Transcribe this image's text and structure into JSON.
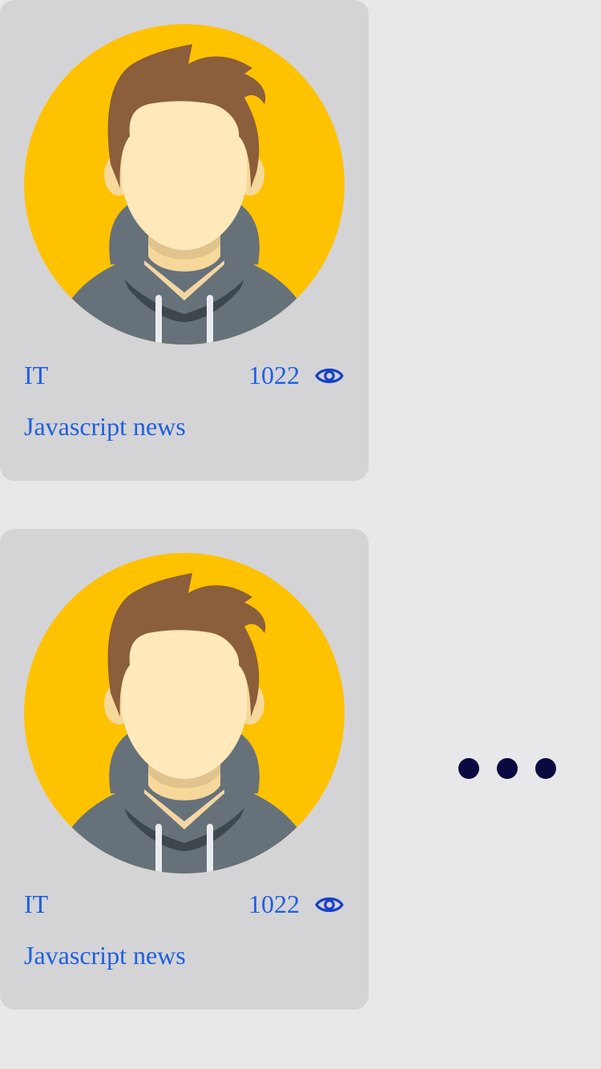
{
  "cards": [
    {
      "category": "IT",
      "views": "1022",
      "title": "Javascript news",
      "avatar_icon": "user-avatar-icon",
      "views_icon": "eye-icon"
    },
    {
      "category": "IT",
      "views": "1022",
      "title": "Javascript news",
      "avatar_icon": "user-avatar-icon",
      "views_icon": "eye-icon"
    }
  ],
  "more_menu": {
    "icon": "more-horizontal-icon"
  },
  "colors": {
    "background": "#e8e8ea",
    "card": "#d4d4d7",
    "link_text": "#1f5fe0",
    "avatar_bg": "#ffc200",
    "dots": "#0b0a40"
  }
}
